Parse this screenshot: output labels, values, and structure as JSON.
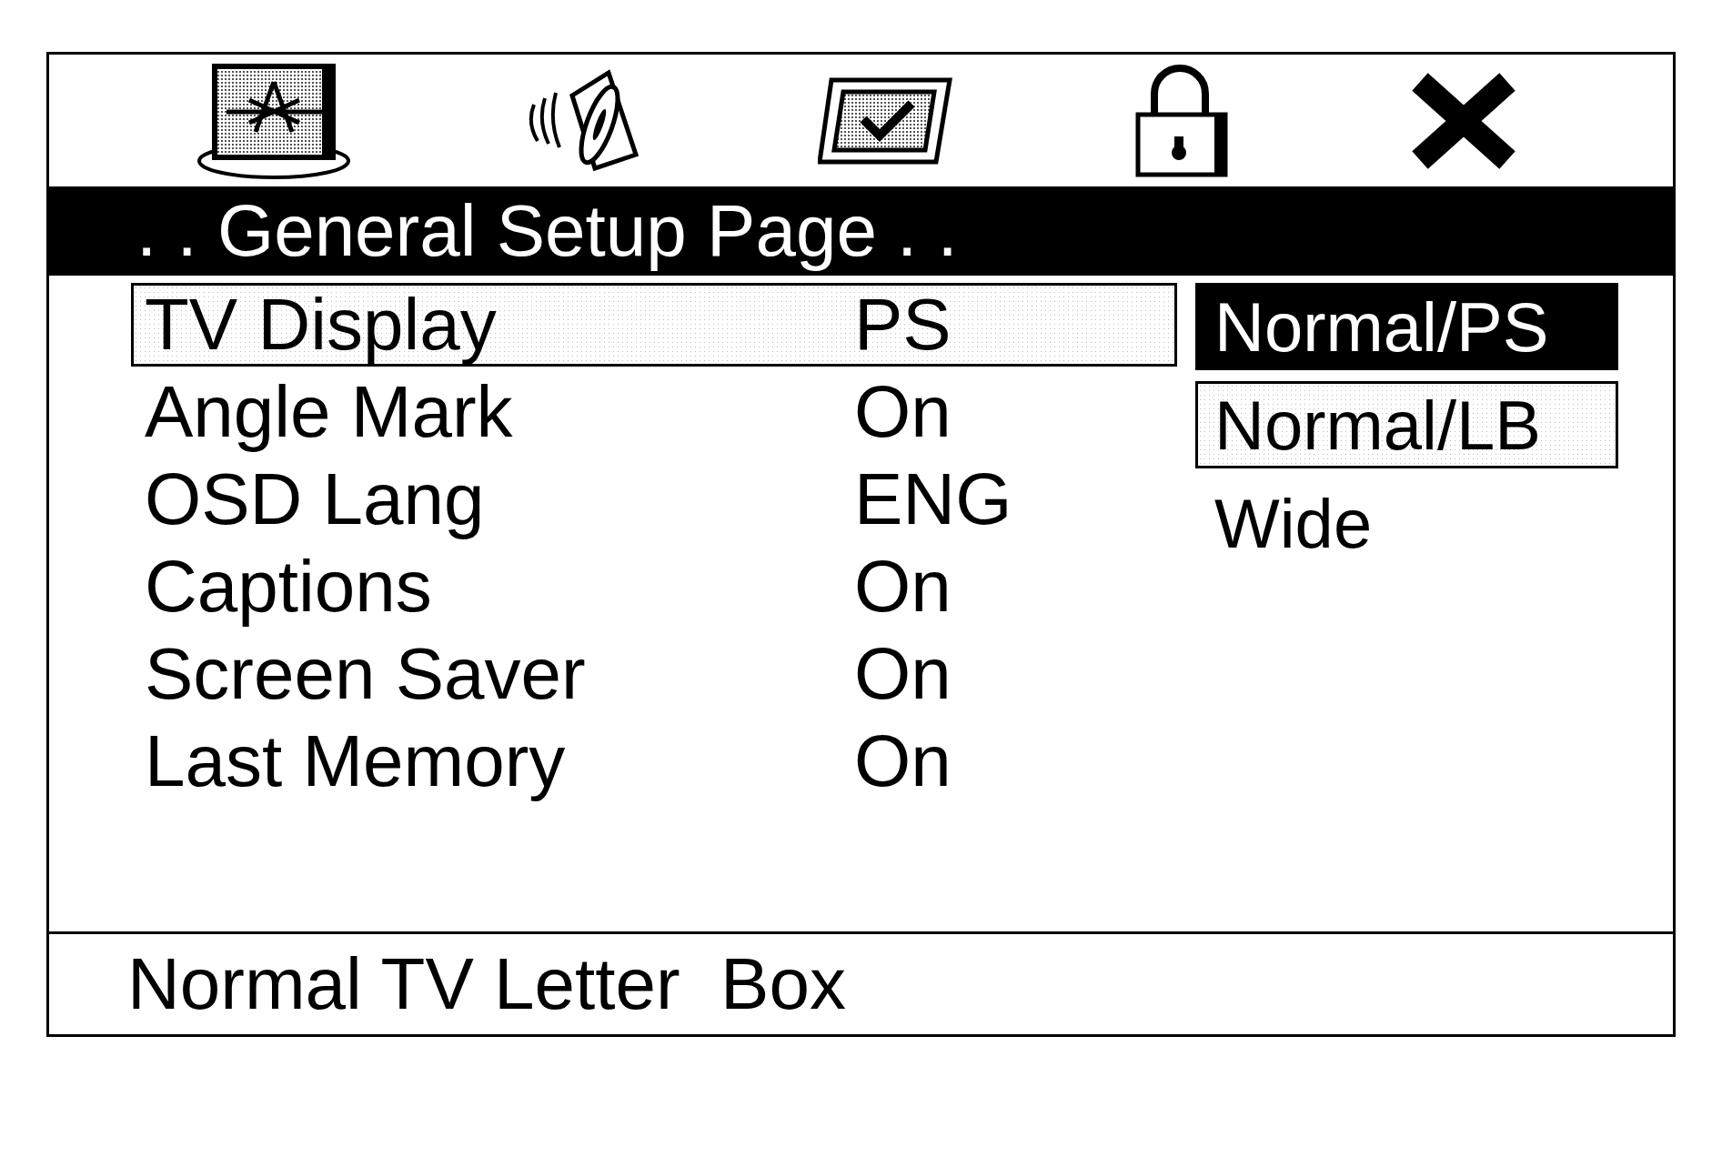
{
  "title": ". . General Setup Page . .",
  "rows": [
    {
      "label": "TV Display",
      "value": "PS",
      "highlighted": true
    },
    {
      "label": "Angle Mark",
      "value": "On",
      "highlighted": false
    },
    {
      "label": "OSD Lang",
      "value": "ENG",
      "highlighted": false
    },
    {
      "label": "Captions",
      "value": "On",
      "highlighted": false
    },
    {
      "label": "Screen Saver",
      "value": "On",
      "highlighted": false
    },
    {
      "label": "Last Memory",
      "value": "On",
      "highlighted": false
    }
  ],
  "options": [
    {
      "label": "Normal/PS",
      "selected": true,
      "highlighted": false
    },
    {
      "label": "Normal/LB",
      "selected": false,
      "highlighted": true
    },
    {
      "label": "Wide",
      "selected": false,
      "highlighted": false
    }
  ],
  "status": "Normal TV Letter  Box"
}
